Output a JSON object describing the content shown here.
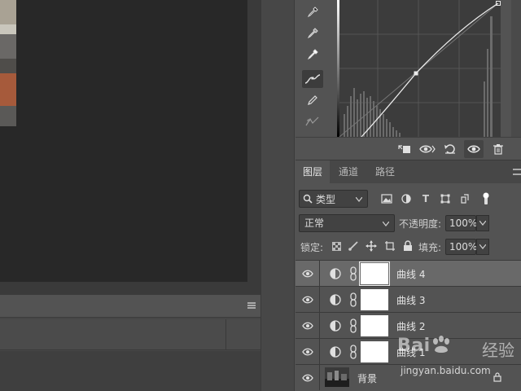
{
  "properties": {
    "tools": [
      {
        "name": "sample-shadows",
        "icon": "eyedropper-black-icon"
      },
      {
        "name": "sample-midtones",
        "icon": "eyedropper-gray-icon"
      },
      {
        "name": "sample-highlights",
        "icon": "eyedropper-white-icon"
      },
      {
        "name": "curve-points",
        "icon": "curve-edit-icon"
      },
      {
        "name": "pencil-draw",
        "icon": "pencil-icon"
      },
      {
        "name": "smooth",
        "icon": "smooth-curve-icon"
      }
    ],
    "footer_icons": [
      "clip-to-layer-icon",
      "view-previous-icon",
      "reset-icon",
      "visibility-icon",
      "trash-icon"
    ]
  },
  "layers_panel": {
    "tabs": [
      {
        "label": "图层",
        "active": true
      },
      {
        "label": "通道",
        "active": false
      },
      {
        "label": "路径",
        "active": false
      }
    ],
    "filter": {
      "label": "类型"
    },
    "blend_mode": "正常",
    "opacity_label": "不透明度:",
    "opacity_value": "100%",
    "lock_label": "锁定:",
    "fill_label": "填充:",
    "fill_value": "100%",
    "layers": [
      {
        "name": "曲线 4",
        "selected": true,
        "type": "curves"
      },
      {
        "name": "曲线 3",
        "selected": false,
        "type": "curves"
      },
      {
        "name": "曲线 2",
        "selected": false,
        "type": "curves"
      },
      {
        "name": "曲线 1",
        "selected": false,
        "type": "curves"
      },
      {
        "name": "背景",
        "selected": false,
        "type": "background"
      }
    ]
  },
  "watermark": {
    "logo": "Bai",
    "logo_suffix": "百",
    "cn": "经验",
    "url": "jingyan.baidu.com"
  },
  "colors": {
    "panel": "#535353",
    "canvas": "#282828",
    "selected_row": "#696969"
  }
}
